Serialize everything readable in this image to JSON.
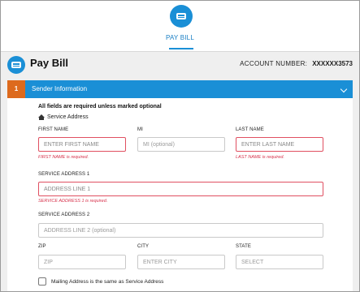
{
  "top_nav": {
    "label": "PAY BILL",
    "icon": "credit-card-icon"
  },
  "header": {
    "title": "Pay Bill",
    "account_label": "ACCOUNT NUMBER:",
    "account_number": "XXXXXX3573"
  },
  "section": {
    "number": "1",
    "title": "Sender Information"
  },
  "form": {
    "required_note": "All fields are required unless marked optional",
    "service_address_heading": "Service Address",
    "first_name": {
      "label": "FIRST NAME",
      "placeholder": "ENTER FIRST NAME",
      "error": "FIRST NAME is required."
    },
    "mi": {
      "label": "MI",
      "placeholder": "MI (optional)"
    },
    "last_name": {
      "label": "LAST NAME",
      "placeholder": "ENTER LAST NAME",
      "error": "LAST NAME is required."
    },
    "address1": {
      "label": "SERVICE ADDRESS 1",
      "placeholder": "ADDRESS LINE 1",
      "error": "SERVICE ADDRESS 1 is required."
    },
    "address2": {
      "label": "SERVICE ADDRESS 2",
      "placeholder": "ADDRESS LINE 2 (optional)"
    },
    "zip": {
      "label": "ZIP",
      "placeholder": "ZIP"
    },
    "city": {
      "label": "CITY",
      "placeholder": "ENTER CITY"
    },
    "state": {
      "label": "STATE",
      "placeholder": "SELECT"
    },
    "mailing_same": {
      "label": "Mailing Address is the same as Service Address",
      "checked": false
    }
  },
  "colors": {
    "accent": "#1a8fd6",
    "step": "#dd6a1d",
    "error": "#d6304a"
  }
}
